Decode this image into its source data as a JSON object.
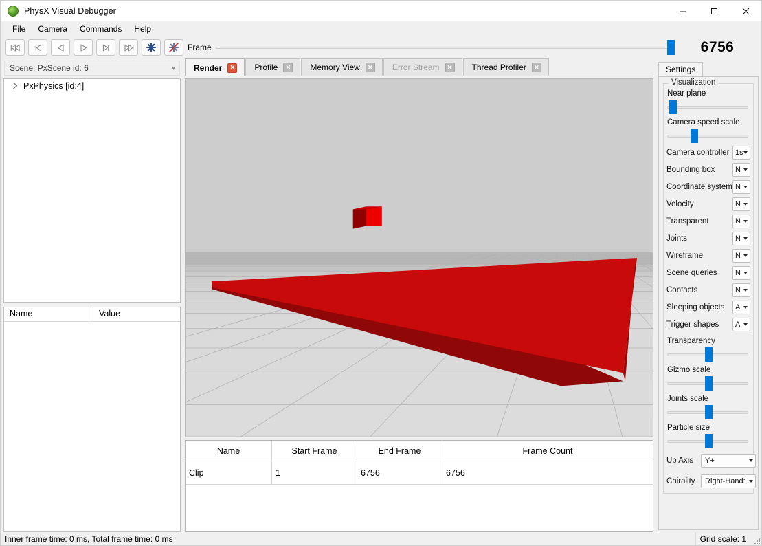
{
  "window": {
    "title": "PhysX Visual Debugger",
    "logo_icon": "physx-logo-icon",
    "minimize_label": "—",
    "maximize_label": "☐",
    "close_label": "✕"
  },
  "menubar": {
    "items": [
      {
        "label": "File"
      },
      {
        "label": "Camera"
      },
      {
        "label": "Commands"
      },
      {
        "label": "Help"
      }
    ]
  },
  "toolbar": {
    "buttons": [
      {
        "name": "goto-start-button",
        "icon": "skip-to-start-icon"
      },
      {
        "name": "previous-clip-button",
        "icon": "step-back-bar-icon"
      },
      {
        "name": "play-reverse-button",
        "icon": "play-reverse-icon"
      },
      {
        "name": "play-button",
        "icon": "play-icon"
      },
      {
        "name": "next-clip-button",
        "icon": "step-forward-bar-icon"
      },
      {
        "name": "goto-end-button",
        "icon": "skip-to-end-icon"
      },
      {
        "name": "connect-button",
        "icon": "asterisk-icon"
      },
      {
        "name": "disconnect-button",
        "icon": "asterisk-disabled-icon"
      }
    ]
  },
  "frame": {
    "label": "Frame",
    "value": "6756",
    "slider_position_percent": 100
  },
  "sidebar": {
    "scene_combo": {
      "value": "Scene: PxScene id: 6",
      "caret_icon": "chevron-down-icon"
    },
    "tree": {
      "items": [
        {
          "label": "PxPhysics [id:4]",
          "arrow_icon": "chevron-right-icon",
          "expanded": false
        }
      ]
    },
    "properties": {
      "columns": [
        "Name",
        "Value"
      ],
      "rows": []
    }
  },
  "tabs": [
    {
      "label": "Render",
      "active": true,
      "disabled": false,
      "close_icon": "close-icon",
      "close_label": "✕"
    },
    {
      "label": "Profile",
      "active": false,
      "disabled": false,
      "close_icon": "close-icon",
      "close_label": "✕"
    },
    {
      "label": "Memory View",
      "active": false,
      "disabled": false,
      "close_icon": "close-icon",
      "close_label": "✕"
    },
    {
      "label": "Error Stream",
      "active": false,
      "disabled": true,
      "close_icon": "close-icon",
      "close_label": "✕"
    },
    {
      "label": "Thread Profiler",
      "active": false,
      "disabled": false,
      "close_icon": "close-icon",
      "close_label": "✕"
    }
  ],
  "viewport": {
    "name": "render-viewport",
    "sky_color": "#cdcdcd",
    "horizon_color": "#b7b7b7",
    "ground_color": "#d9d9d9",
    "grid_line_color": "#b0b0b0",
    "platform_top_color": "#cc0000",
    "platform_side_color": "#8f0707",
    "box_light_color": "#e60000",
    "box_dark_color": "#8f0000"
  },
  "clip_table": {
    "columns": [
      "Name",
      "Start Frame",
      "End Frame",
      "Frame Count"
    ],
    "rows": [
      {
        "name": "Clip",
        "start_frame": "1",
        "end_frame": "6756",
        "frame_count": "6756"
      }
    ]
  },
  "settings": {
    "tab_label": "Settings",
    "group_title": "Visualization",
    "sliders": [
      {
        "label": "Near plane",
        "position_percent": 3
      },
      {
        "label": "Camera speed scale",
        "position_percent": 29
      },
      {
        "label": "Transparency",
        "position_percent": 46
      },
      {
        "label": "Gizmo scale",
        "position_percent": 46
      },
      {
        "label": "Joints scale",
        "position_percent": 46
      },
      {
        "label": "Particle size",
        "position_percent": 46
      }
    ],
    "combos": [
      {
        "label": "Camera controller",
        "value": "1s"
      },
      {
        "label": "Bounding box",
        "value": "N"
      },
      {
        "label": "Coordinate system",
        "value": "N"
      },
      {
        "label": "Velocity",
        "value": "N"
      },
      {
        "label": "Transparent",
        "value": "N"
      },
      {
        "label": "Joints",
        "value": "N"
      },
      {
        "label": "Wireframe",
        "value": "N"
      },
      {
        "label": "Scene queries",
        "value": "N"
      },
      {
        "label": "Contacts",
        "value": "N"
      },
      {
        "label": "Sleeping objects",
        "value": "A"
      },
      {
        "label": "Trigger shapes",
        "value": "A"
      }
    ],
    "axis": [
      {
        "label": "Up Axis",
        "value": "Y+"
      },
      {
        "label": "Chirality",
        "value": "Right-Hand:"
      }
    ]
  },
  "statusbar": {
    "left": "Inner frame time: 0 ms, Total frame time: 0 ms",
    "right": "Grid scale: 1"
  }
}
